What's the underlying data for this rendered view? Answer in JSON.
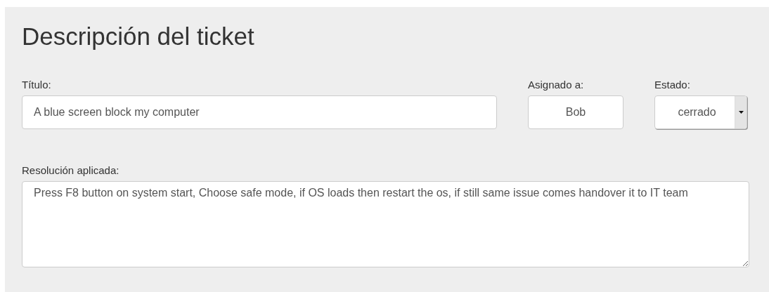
{
  "heading": "Descripción del ticket",
  "fields": [
    {
      "label": "Título:",
      "value": "A blue screen block my computer",
      "kind": "text"
    },
    {
      "label": "Asignado a:",
      "value": "Bob",
      "kind": "text"
    },
    {
      "label": "Estado:",
      "value": "cerrado",
      "kind": "select"
    }
  ],
  "resolution": {
    "label": "Resolución aplicada:",
    "value": "Press F8 button on system start, Choose safe mode, if OS loads then restart the os, if still same issue comes handover it to IT team"
  }
}
